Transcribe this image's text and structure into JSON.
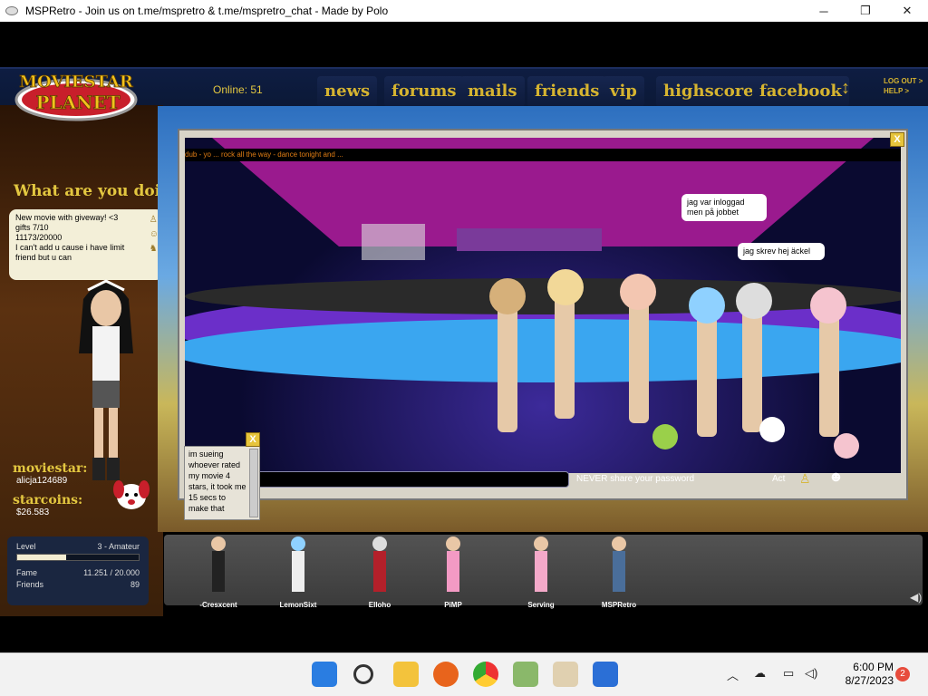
{
  "window": {
    "title": "MSPRetro - Join us on t.me/mspretro & t.me/mspretro_chat - Made by Polo",
    "minimize": "─",
    "maximize": "❐",
    "close": "✕"
  },
  "nav": {
    "online": "Online: 51",
    "items": [
      "news",
      "forums",
      "mails",
      "friends",
      "vip",
      "highscores",
      "facebook"
    ],
    "arrow": "↕",
    "logout": "LOG OUT >",
    "help": "HELP >"
  },
  "logo": {
    "line1": "MOVIESTAR",
    "line2": "PLANET"
  },
  "left": {
    "what_doing": "What are you doing?",
    "status_lines": [
      "New movie with  giveway! <3",
      "gifts 7/10",
      "11173/20000",
      "I can't add u cause i have limit",
      "friend but u can"
    ],
    "moviestar_label": "moviestar:",
    "username": "alicja124689",
    "starcoins_label": "starcoins:",
    "starcoins": "$26.583",
    "level_label": "Level",
    "level_value": "3 - Amateur",
    "level_progress": 0.4,
    "fame_label": "Fame",
    "fame_value": "11.251 / 20.000",
    "friends_label": "Friends",
    "friends_value": "89"
  },
  "room": {
    "ticker": "dub - yo ... rock all the way - dance tonight and ...",
    "bubble1": "jag var inloggad men på jobbet",
    "bubble2": "jag skrev hej äckel",
    "close": "X"
  },
  "chat": {
    "warning": "NEVER share your password",
    "act": "Act",
    "log": "im sueing whoever rated my movie 4 stars, it took me 15 secs to make that",
    "close": "X"
  },
  "friends": [
    {
      "name": "-Cresxcent"
    },
    {
      "name": "LemonSixt"
    },
    {
      "name": "Elloho"
    },
    {
      "name": "PiMP"
    },
    {
      "name": "Serving"
    },
    {
      "name": "MSPRetro"
    }
  ],
  "taskbar": {
    "time": "6:00 PM",
    "date": "8/27/2023",
    "notifications": "2"
  },
  "colors": {
    "gold": "#d6b430",
    "accent_pink": "#e23a8f"
  }
}
